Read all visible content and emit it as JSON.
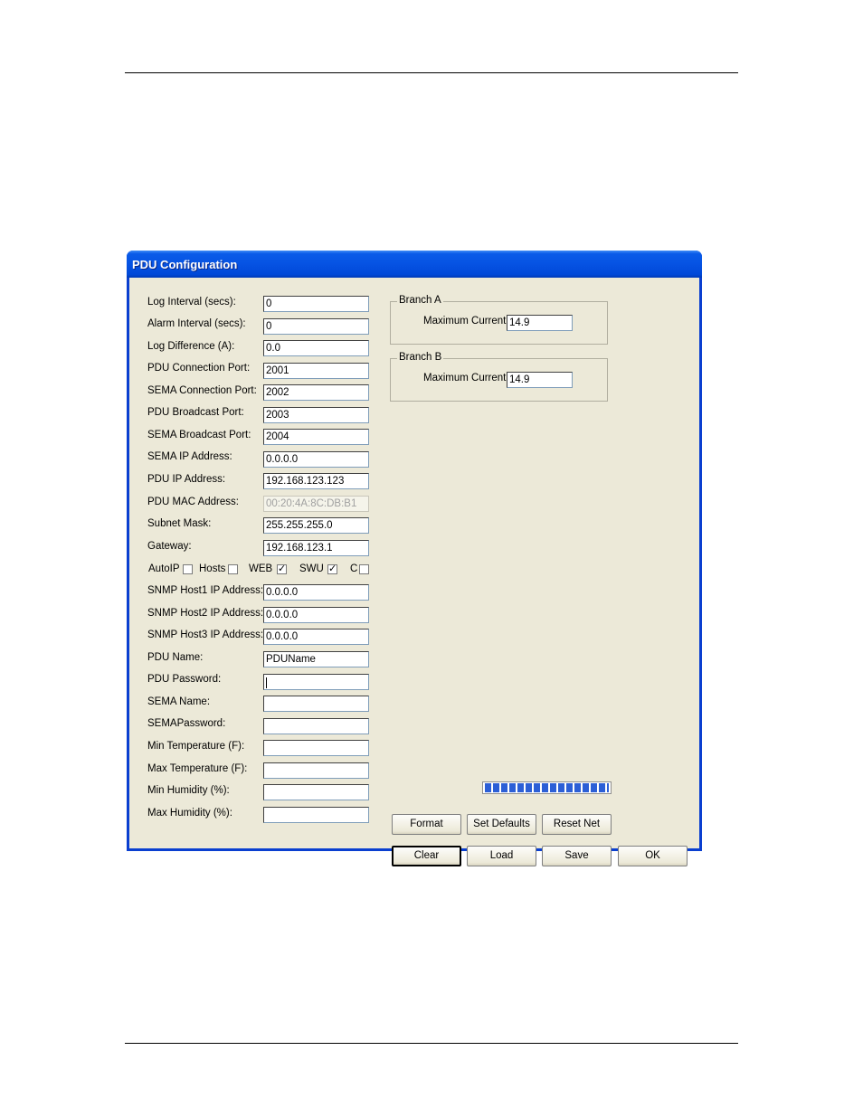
{
  "window": {
    "title": "PDU Configuration"
  },
  "form": {
    "rows": [
      {
        "label": "Log Interval (secs):",
        "value": "0"
      },
      {
        "label": "Alarm Interval (secs):",
        "value": "0"
      },
      {
        "label": "Log Difference (A):",
        "value": "0.0"
      },
      {
        "label": "PDU Connection Port:",
        "value": "2001"
      },
      {
        "label": "SEMA Connection Port:",
        "value": "2002"
      },
      {
        "label": "PDU Broadcast Port:",
        "value": "2003"
      },
      {
        "label": "SEMA Broadcast Port:",
        "value": "2004"
      },
      {
        "label": "SEMA IP Address:",
        "value": "0.0.0.0"
      },
      {
        "label": "PDU IP Address:",
        "value": "192.168.123.123"
      },
      {
        "label": "PDU MAC Address:",
        "value": "00:20:4A:8C:DB:B1"
      },
      {
        "label": "Subnet Mask:",
        "value": "255.255.255.0"
      },
      {
        "label": "Gateway:",
        "value": "192.168.123.1"
      }
    ],
    "checkboxes": [
      {
        "label": "AutoIP",
        "checked": false
      },
      {
        "label": "Hosts",
        "checked": false
      },
      {
        "label": "WEB",
        "checked": true
      },
      {
        "label": "SWU",
        "checked": true
      },
      {
        "label": "C",
        "checked": false
      }
    ],
    "rows2": [
      {
        "label": "SNMP Host1 IP Address:",
        "value": "0.0.0.0"
      },
      {
        "label": "SNMP Host2 IP Address:",
        "value": "0.0.0.0"
      },
      {
        "label": "SNMP Host3 IP Address:",
        "value": "0.0.0.0"
      },
      {
        "label": "PDU Name:",
        "value": "PDUName"
      },
      {
        "label": "PDU Password:",
        "value": ""
      },
      {
        "label": "SEMA Name:",
        "value": ""
      },
      {
        "label": "SEMAPassword:",
        "value": ""
      },
      {
        "label": "Min Temperature (F):",
        "value": ""
      },
      {
        "label": "Max Temperature (F):",
        "value": ""
      },
      {
        "label": "Min Humidity (%):",
        "value": ""
      },
      {
        "label": "Max Humidity (%):",
        "value": ""
      }
    ]
  },
  "branches": [
    {
      "title": "Branch A",
      "label": "Maximum Current:",
      "value": "14.9"
    },
    {
      "title": "Branch B",
      "label": "Maximum Current:",
      "value": "14.9"
    }
  ],
  "progress": {
    "fraction": 1.0
  },
  "buttons": {
    "format": "Format",
    "set_defaults": "Set Defaults",
    "reset_net": "Reset Net",
    "clear": "Clear",
    "load": "Load",
    "save": "Save",
    "ok": "OK"
  }
}
